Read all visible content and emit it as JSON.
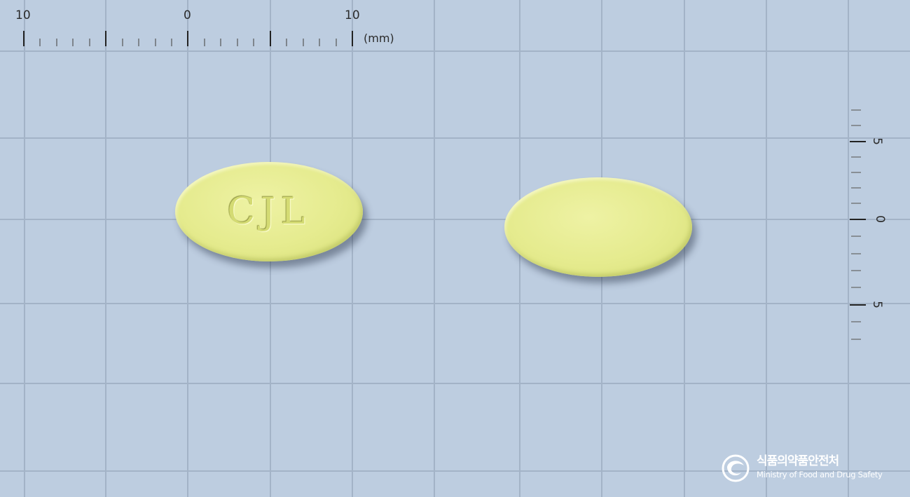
{
  "ruler_top": {
    "labels": [
      "10",
      "0",
      "10"
    ],
    "unit": "(mm)"
  },
  "ruler_right": {
    "labels": [
      "5",
      "0",
      "5"
    ]
  },
  "tablets": [
    {
      "imprint": "CJL",
      "color": "#e5eb8e"
    },
    {
      "imprint": "",
      "color": "#e5eb8e"
    }
  ],
  "watermark": {
    "korean": "식품의약품안전처",
    "english": "Ministry of Food and Drug Safety"
  },
  "colors": {
    "background": "#bdcde0",
    "grid_major": "#a5b5c8",
    "tablet": "#e5eb8e"
  }
}
